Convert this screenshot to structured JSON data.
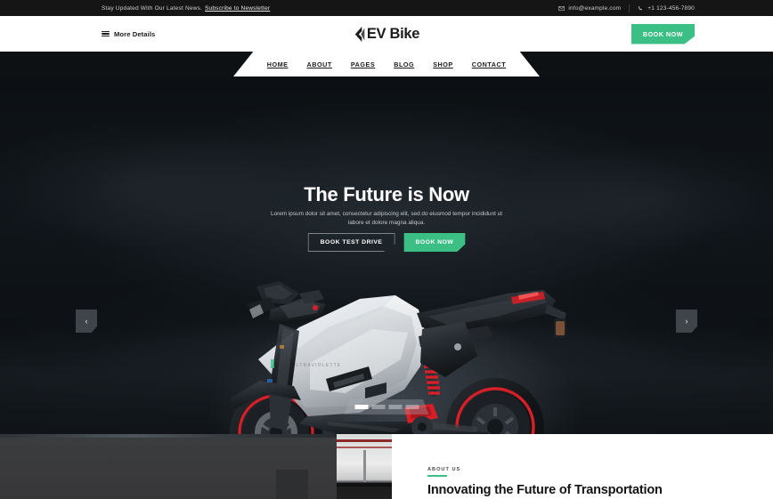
{
  "topbar": {
    "news_text": "Stay Updated With Our Latest News.",
    "newsletter_link": "Subscribe to Newsletter",
    "email": "info@example.com",
    "phone": "+1 123-456-7890",
    "email_icon": "envelope-icon",
    "phone_icon": "phone-icon",
    "bg_color": "#151515"
  },
  "header": {
    "more_details": "More Details",
    "menu_icon": "hamburger-icon",
    "logo_text": "EV Bike",
    "logo_mark_icon": "chevron-left-logo-icon",
    "book_now": "BOOK NOW",
    "accent_color": "#3bbf84"
  },
  "nav": {
    "items": [
      {
        "label": "HOME"
      },
      {
        "label": "ABOUT"
      },
      {
        "label": "PAGES"
      },
      {
        "label": "BLOG"
      },
      {
        "label": "SHOP"
      },
      {
        "label": "CONTACT"
      }
    ]
  },
  "hero": {
    "title": "The Future is Now",
    "subtitle": "Lorem ipsum dolor sit amet, consectetur adipiscing elit, sed do eiusmod tempor incididunt ut labore et dolore magna aliqua.",
    "btn_outline": "BOOK TEST DRIVE",
    "btn_primary": "BOOK NOW",
    "prev_icon": "chevron-left-icon",
    "next_icon": "chevron-right-icon",
    "prev_glyph": "‹",
    "next_glyph": "›",
    "slides_total": 4,
    "active_slide": 1,
    "bg_color": "#0d1114",
    "product_name": "ULTRAVIOLETTE"
  },
  "about": {
    "eyebrow": "ABOUT US",
    "heading": "Innovating the Future of Transportation",
    "accent_color": "#3bbf84"
  }
}
